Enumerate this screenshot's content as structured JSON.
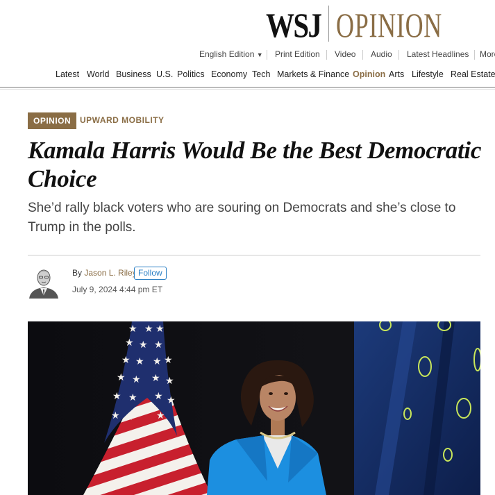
{
  "masthead": {
    "logo_wsj": "WSJ",
    "logo_opinion": "OPINION"
  },
  "utility_nav": {
    "edition": "English Edition",
    "caret": "▼",
    "items": [
      "Print Edition",
      "Video",
      "Audio",
      "Latest Headlines",
      "More"
    ]
  },
  "main_nav": {
    "items": [
      "Latest",
      "World",
      "Business",
      "U.S.",
      "Politics",
      "Economy",
      "Tech",
      "Markets & Finance",
      "Opinion",
      "Arts",
      "Lifestyle",
      "Real Estate"
    ],
    "active": "Opinion"
  },
  "article": {
    "flag": "OPINION",
    "section": "UPWARD MOBILITY",
    "headline": "Kamala Harris Would Be the Best Democratic Choice",
    "dek": "She’d rally black voters who are souring on Democrats and she’s close to Trump in the polls.",
    "byline_prefix": "By ",
    "author": "Jason L. Riley",
    "follow_label": "Follow",
    "date": "July 9, 2024 4:44 pm ET"
  },
  "colors": {
    "brand": "#8a6d45",
    "link_blue": "#2a7fc4",
    "photo_bg": "#111111"
  }
}
